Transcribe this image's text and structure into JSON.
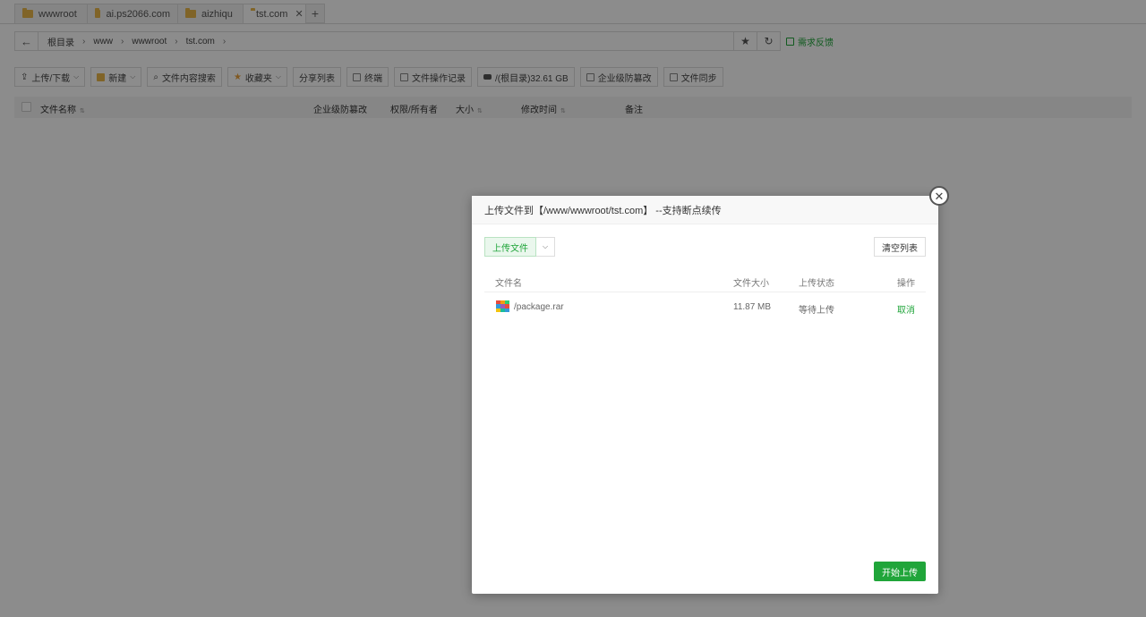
{
  "tabs": [
    {
      "label": "wwwroot",
      "active": false
    },
    {
      "label": "ai.ps2066.com",
      "active": false
    },
    {
      "label": "aizhiqu",
      "active": false
    },
    {
      "label": "tst.com",
      "active": true
    }
  ],
  "tab_add_label": "+",
  "tab_close_label": "✕",
  "breadcrumb": [
    "根目录",
    "www",
    "wwwroot",
    "tst.com"
  ],
  "feedback_label": "需求反馈",
  "toolbar": {
    "upload_download": "上传/下载",
    "new": "新建",
    "content_search": "文件内容搜索",
    "favorites": "收藏夹",
    "share_list": "分享列表",
    "terminal": "终端",
    "op_log": "文件操作记录",
    "disk": "/(根目录)32.61 GB",
    "tamper": "企业级防篡改",
    "file_sync": "文件同步"
  },
  "table_headers": {
    "name": "文件名称",
    "tamper": "企业级防篡改",
    "perm": "权限/所有者",
    "size": "大小",
    "mtime": "修改时间",
    "remark": "备注"
  },
  "modal": {
    "title": "上传文件到【/www/wwwroot/tst.com】 --支持断点续传",
    "upload_button": "上传文件",
    "clear_button": "清空列表",
    "columns": {
      "name": "文件名",
      "size": "文件大小",
      "status": "上传状态",
      "action": "操作"
    },
    "files": [
      {
        "name": "/package.rar",
        "size": "11.87 MB",
        "status": "等待上传",
        "action": "取消"
      }
    ],
    "start_button": "开始上传"
  },
  "colors": {
    "accent": "#20a53a",
    "overlay": "rgba(0,0,0,0.45)"
  }
}
